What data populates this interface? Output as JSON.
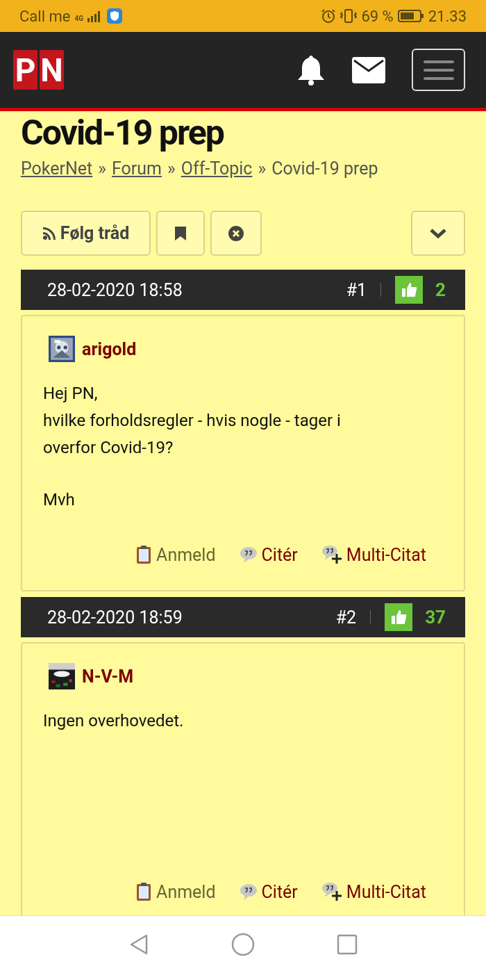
{
  "status_bar": {
    "carrier": "Call me",
    "network": "4G",
    "battery": "69 %",
    "time": "21.33"
  },
  "header": {
    "logo": [
      "P",
      "N"
    ]
  },
  "title": "Covid-19 prep",
  "breadcrumb": {
    "separator": "»",
    "items": [
      {
        "label": "PokerNet",
        "link": true
      },
      {
        "label": "Forum",
        "link": true
      },
      {
        "label": "Off-Topic",
        "link": true
      },
      {
        "label": "Covid-19 prep",
        "link": false
      }
    ]
  },
  "toolbar": {
    "follow_label": "Følg tråd"
  },
  "posts": [
    {
      "date": "28-02-2020 18:58",
      "number": "#1",
      "likes": "2",
      "author": "arigold",
      "avatar": {
        "kind": "picture"
      },
      "body": [
        "Hej PN,\nhvilke forholdsregler - hvis nogle - tager i overfor Covid-19?",
        "Mvh"
      ],
      "actions": [
        {
          "kind": "report",
          "label": "Anmeld"
        },
        {
          "kind": "quote",
          "label": "Citér"
        },
        {
          "kind": "multiquote",
          "label": "Multi-Citat"
        }
      ]
    },
    {
      "date": "28-02-2020 18:59",
      "number": "#2",
      "likes": "37",
      "author": "N-V-M",
      "avatar": {
        "kind": "picture"
      },
      "body": [
        "Ingen overhovedet."
      ],
      "actions": [
        {
          "kind": "report",
          "label": "Anmeld"
        },
        {
          "kind": "quote",
          "label": "Citér"
        },
        {
          "kind": "multiquote",
          "label": "Multi-Citat"
        }
      ]
    }
  ]
}
